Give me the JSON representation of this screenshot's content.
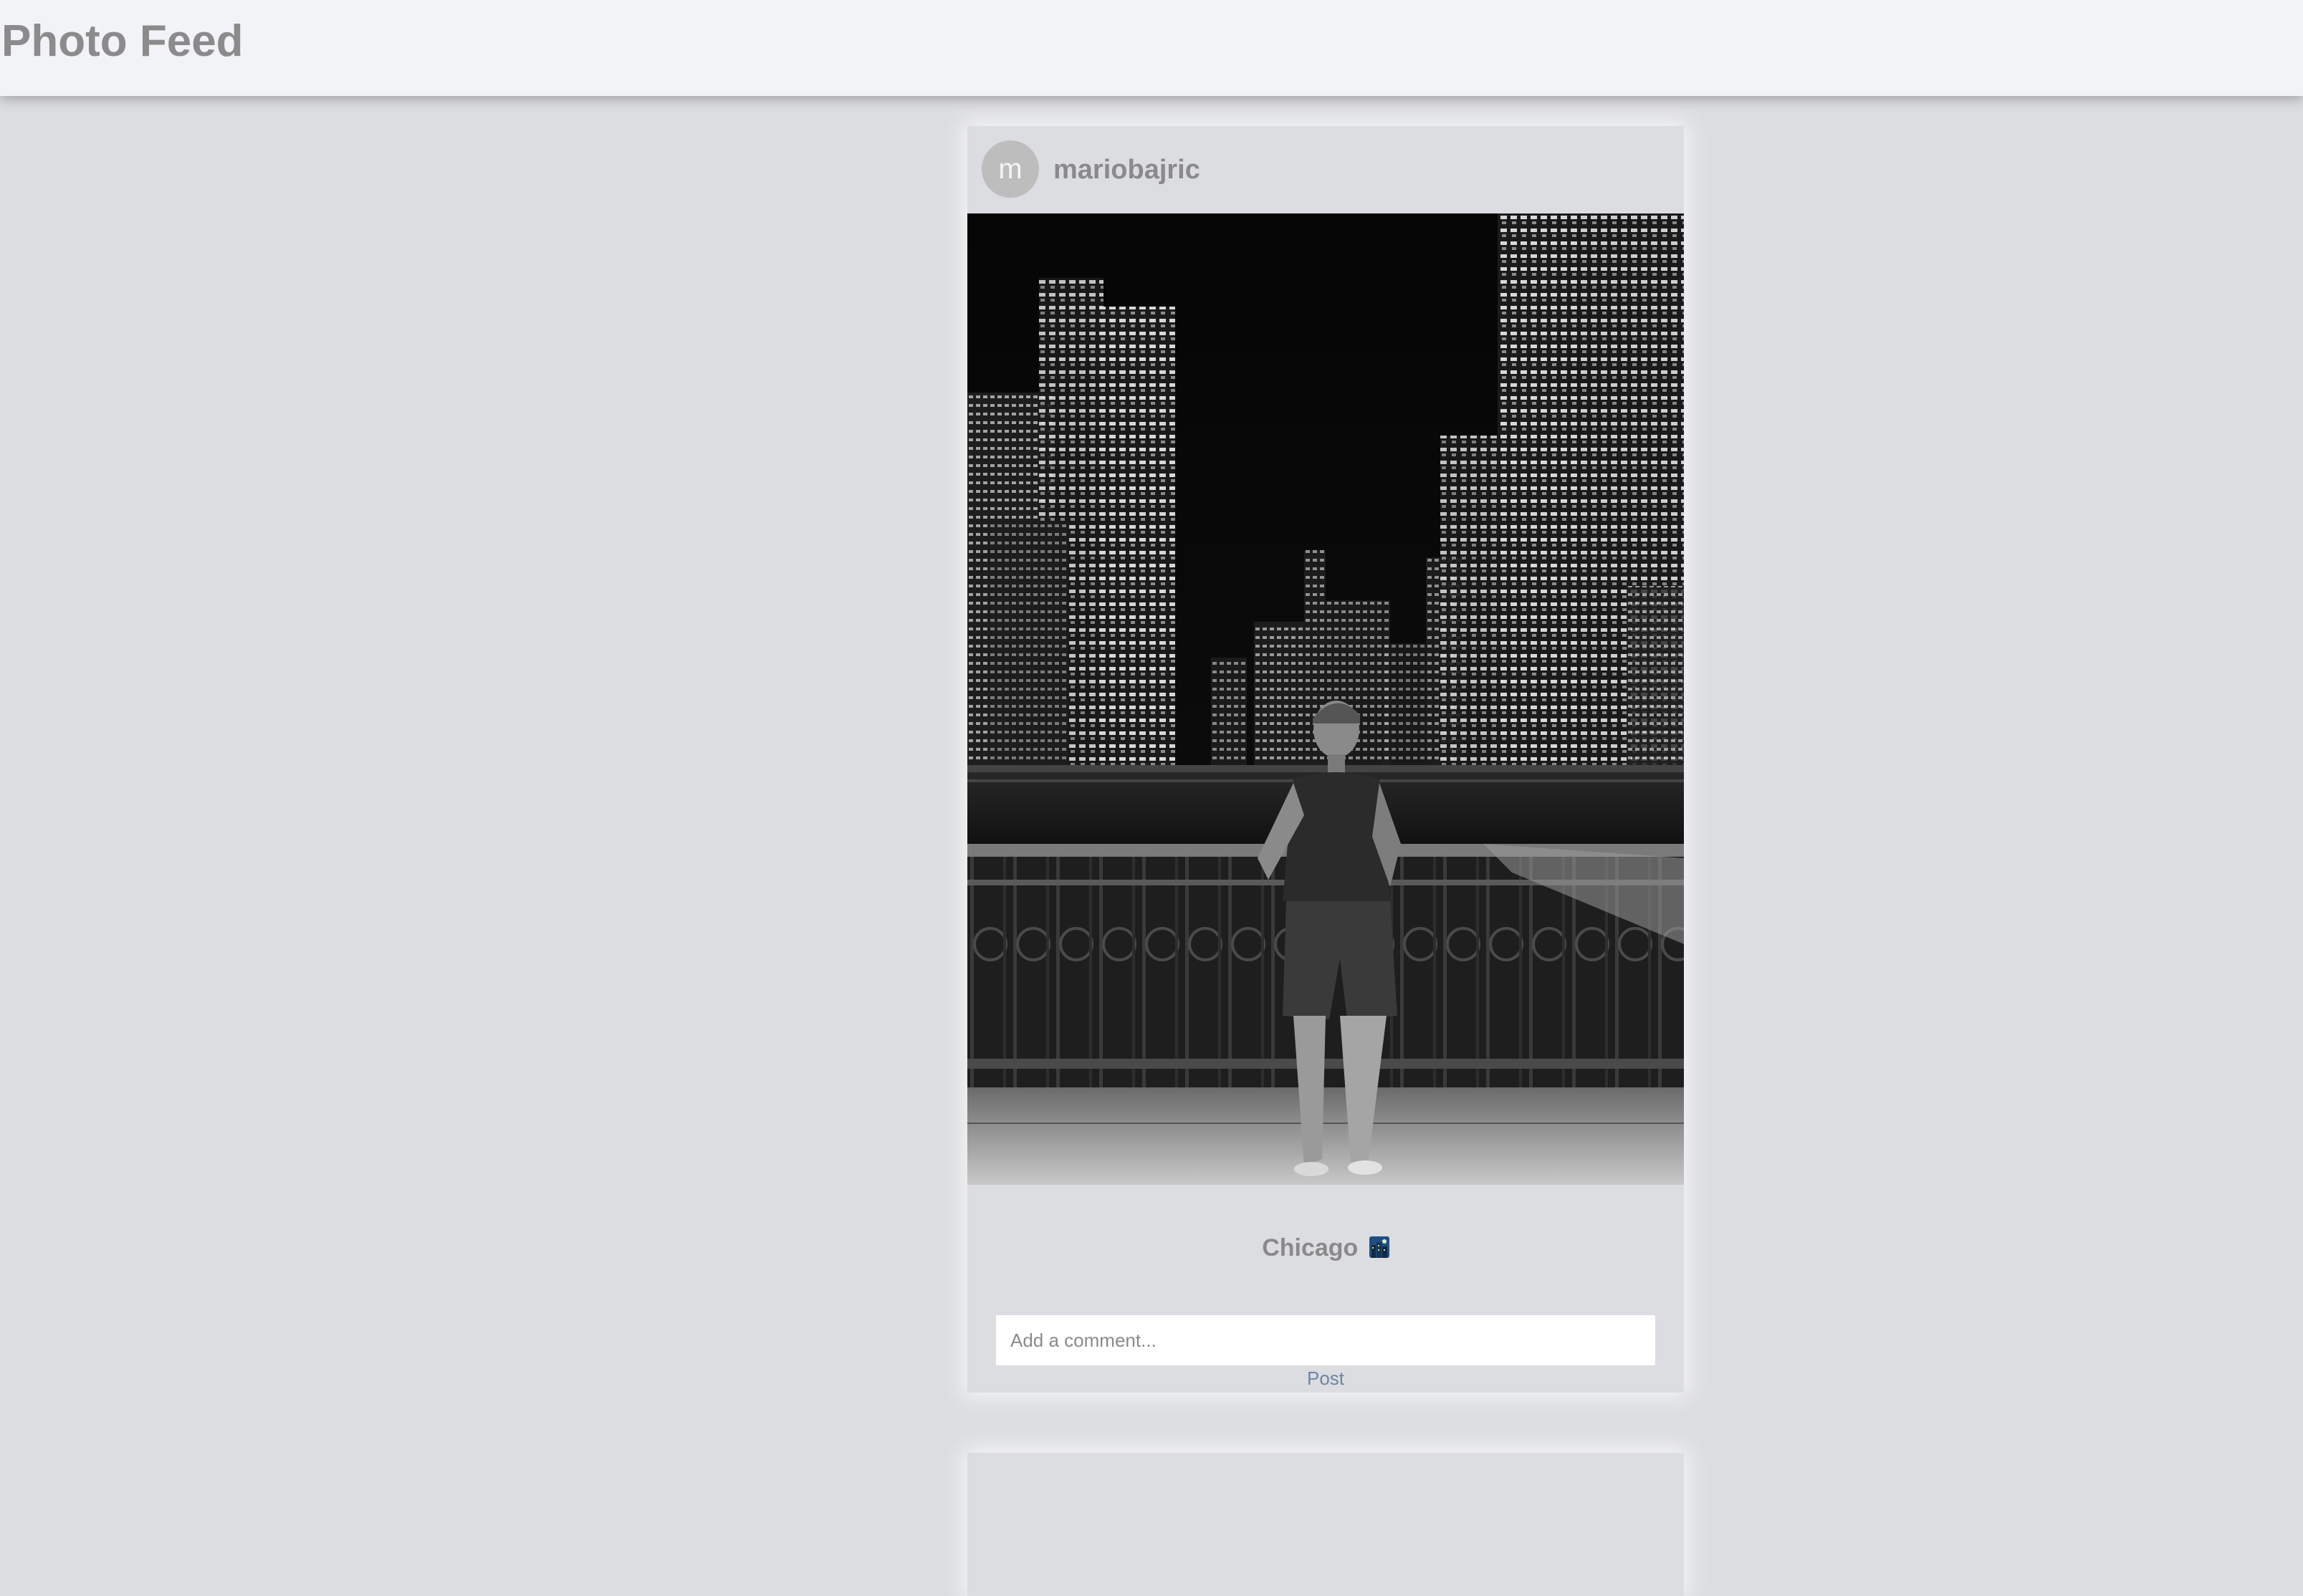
{
  "header": {
    "title": "Photo Feed"
  },
  "post": {
    "avatar_initial": "m",
    "username": "mariobajric",
    "photo_subject": "night city skyline black and white portrait",
    "caption": "Chicago",
    "caption_emoji": "city-night-emoji",
    "comment": {
      "placeholder": "Add a comment...",
      "value": ""
    },
    "post_button_label": "Post"
  },
  "colors": {
    "topbar_bg": "#f2f3f6",
    "page_bg": "#dcdde0",
    "title_text": "#8b8b8b",
    "link_blue": "#6d85a8",
    "avatar_bg": "#bdbdbd"
  }
}
